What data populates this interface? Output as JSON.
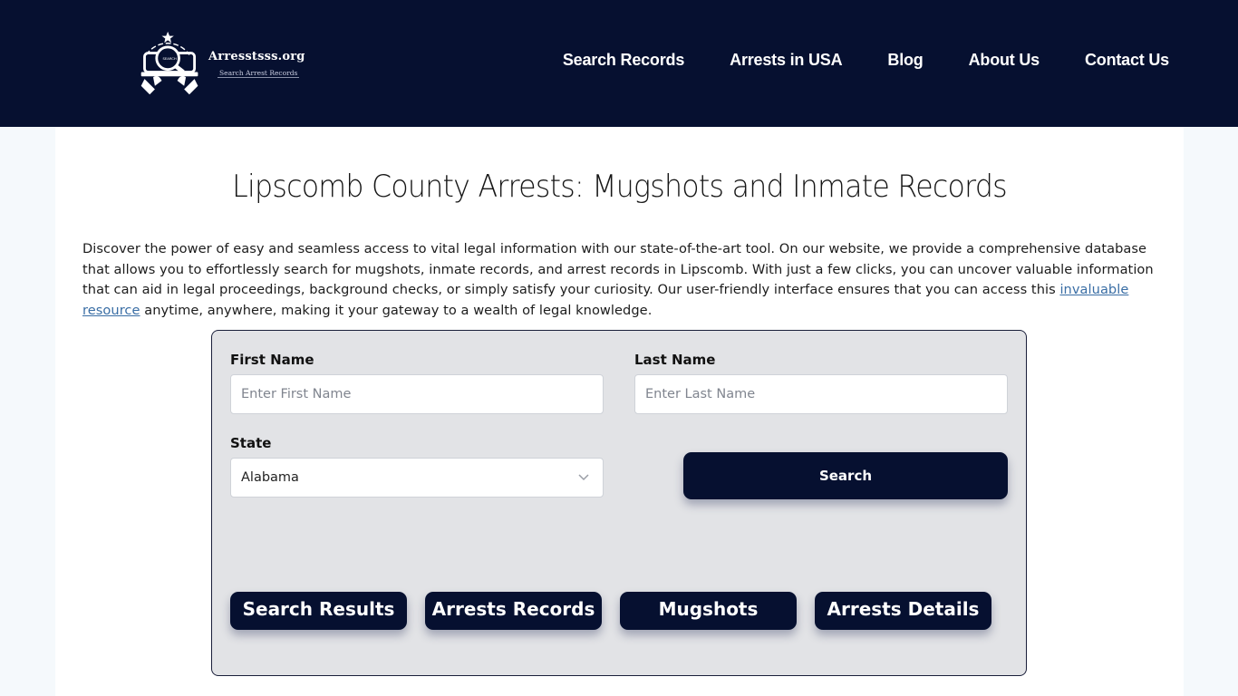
{
  "header": {
    "logo": {
      "icon": "magnifier-search-badge-icon",
      "name": "Arresstsss.org",
      "tagline": "Search Arrest Records"
    },
    "nav": [
      {
        "label": "Search Records"
      },
      {
        "label": "Arrests in USA"
      },
      {
        "label": "Blog"
      },
      {
        "label": "About Us"
      },
      {
        "label": "Contact Us"
      }
    ]
  },
  "main": {
    "title": "Lipscomb County Arrests: Mugshots and Inmate Records",
    "intro": {
      "before_link": "Discover the power of easy and seamless access to vital legal information with our state-of-the-art tool. On our website, we provide a comprehensive database that allows you to effortlessly search for mugshots, inmate records, and arrest records in Lipscomb. With just a few clicks, you can uncover valuable information that can aid in legal proceedings, background checks, or simply satisfy your curiosity. Our user-friendly interface ensures that you can access this ",
      "link_text": "invaluable resource",
      "after_link": " anytime, anywhere, making it your gateway to a wealth of legal knowledge."
    },
    "form": {
      "first_name_label": "First Name",
      "first_name_placeholder": "Enter First Name",
      "first_name_value": "",
      "last_name_label": "Last Name",
      "last_name_placeholder": "Enter Last Name",
      "last_name_value": "",
      "state_label": "State",
      "state_selected": "Alabama",
      "search_label": "Search"
    },
    "tabs": [
      {
        "label": "Search Results"
      },
      {
        "label": "Arrests Records"
      },
      {
        "label": "Mugshots"
      },
      {
        "label": "Arrests Details"
      }
    ]
  },
  "colors": {
    "header_bg": "#061030",
    "button_bg": "#061030",
    "card_bg": "#e2e3e6",
    "link": "#3a6ea5",
    "page_bg": "#f5f9fc"
  }
}
